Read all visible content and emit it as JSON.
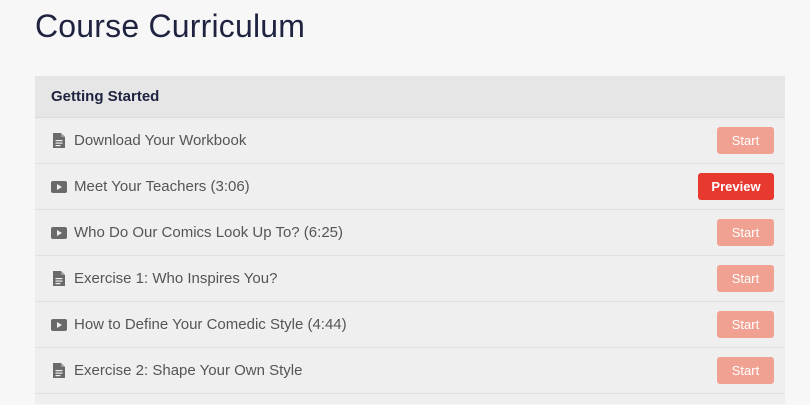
{
  "page": {
    "title": "Course Curriculum"
  },
  "colors": {
    "title_text": "#1f2340",
    "section_bg": "#e6e6e6",
    "row_bg": "#efefef",
    "start_button": "#f0a191",
    "preview_button": "#e8392f"
  },
  "section": {
    "title": "Getting Started",
    "lectures": [
      {
        "icon": "document-icon",
        "title": "Download Your Workbook",
        "action": "Start"
      },
      {
        "icon": "video-play-icon",
        "title": "Meet Your Teachers (3:06)",
        "action": "Preview"
      },
      {
        "icon": "video-play-icon",
        "title": "Who Do Our Comics Look Up To? (6:25)",
        "action": "Start"
      },
      {
        "icon": "document-icon",
        "title": "Exercise 1: Who Inspires You?",
        "action": "Start"
      },
      {
        "icon": "video-play-icon",
        "title": "How to Define Your Comedic Style (4:44)",
        "action": "Start"
      },
      {
        "icon": "document-icon",
        "title": "Exercise 2: Shape Your Own Style",
        "action": "Start"
      }
    ]
  }
}
